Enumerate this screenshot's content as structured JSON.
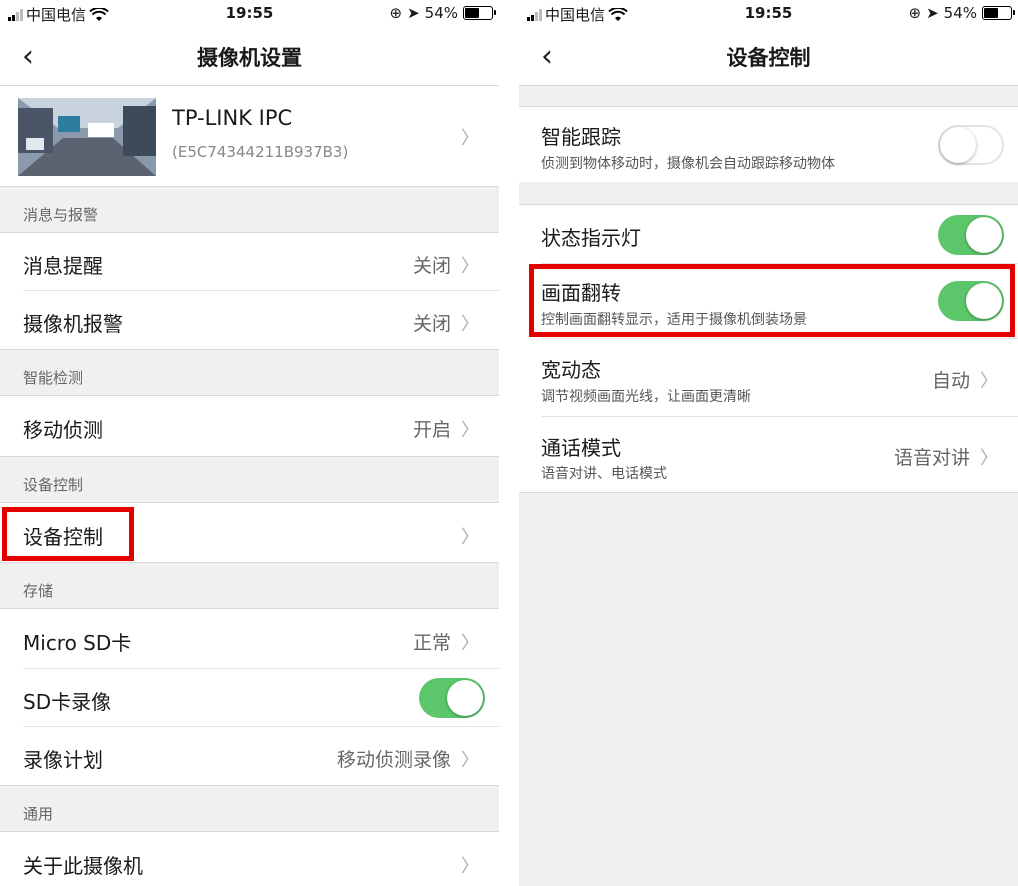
{
  "left": {
    "status": {
      "carrier": "中国电信",
      "time": "19:55",
      "battery": "54%"
    },
    "nav": {
      "title": "摄像机设置"
    },
    "device": {
      "name": "TP-LINK IPC",
      "id": "(E5C74344211B937B3)"
    },
    "sections": {
      "messages": "消息与报警",
      "detection": "智能检测",
      "control": "设备控制",
      "storage": "存储",
      "general": "通用"
    },
    "items": {
      "msg_reminder": {
        "label": "消息提醒",
        "value": "关闭"
      },
      "cam_alarm": {
        "label": "摄像机报警",
        "value": "关闭"
      },
      "motion": {
        "label": "移动侦测",
        "value": "开启"
      },
      "device_control": {
        "label": "设备控制"
      },
      "sdcard": {
        "label": "Micro SD卡",
        "value": "正常"
      },
      "sd_record": {
        "label": "SD卡录像",
        "on": true
      },
      "record_plan": {
        "label": "录像计划",
        "value": "移动侦测录像"
      },
      "about": {
        "label": "关于此摄像机"
      }
    }
  },
  "right": {
    "status": {
      "carrier": "中国电信",
      "time": "19:55",
      "battery": "54%"
    },
    "nav": {
      "title": "设备控制"
    },
    "items": {
      "tracking": {
        "label": "智能跟踪",
        "sub": "侦测到物体移动时，摄像机会自动跟踪移动物体",
        "on": false
      },
      "indicator": {
        "label": "状态指示灯",
        "on": true
      },
      "flip": {
        "label": "画面翻转",
        "sub": "控制画面翻转显示，适用于摄像机倒装场景",
        "on": true
      },
      "wdr": {
        "label": "宽动态",
        "sub": "调节视频画面光线，让画面更清晰",
        "value": "自动"
      },
      "talk": {
        "label": "通话模式",
        "sub": "语音对讲、电话模式",
        "value": "语音对讲"
      }
    }
  },
  "colors": {
    "toggle_on": "#5cc66a",
    "highlight": "#e50000"
  },
  "icons": {
    "back": "chevron-left-icon",
    "more": "chevron-right-icon",
    "wifi": "wifi-icon",
    "battery": "battery-icon"
  }
}
